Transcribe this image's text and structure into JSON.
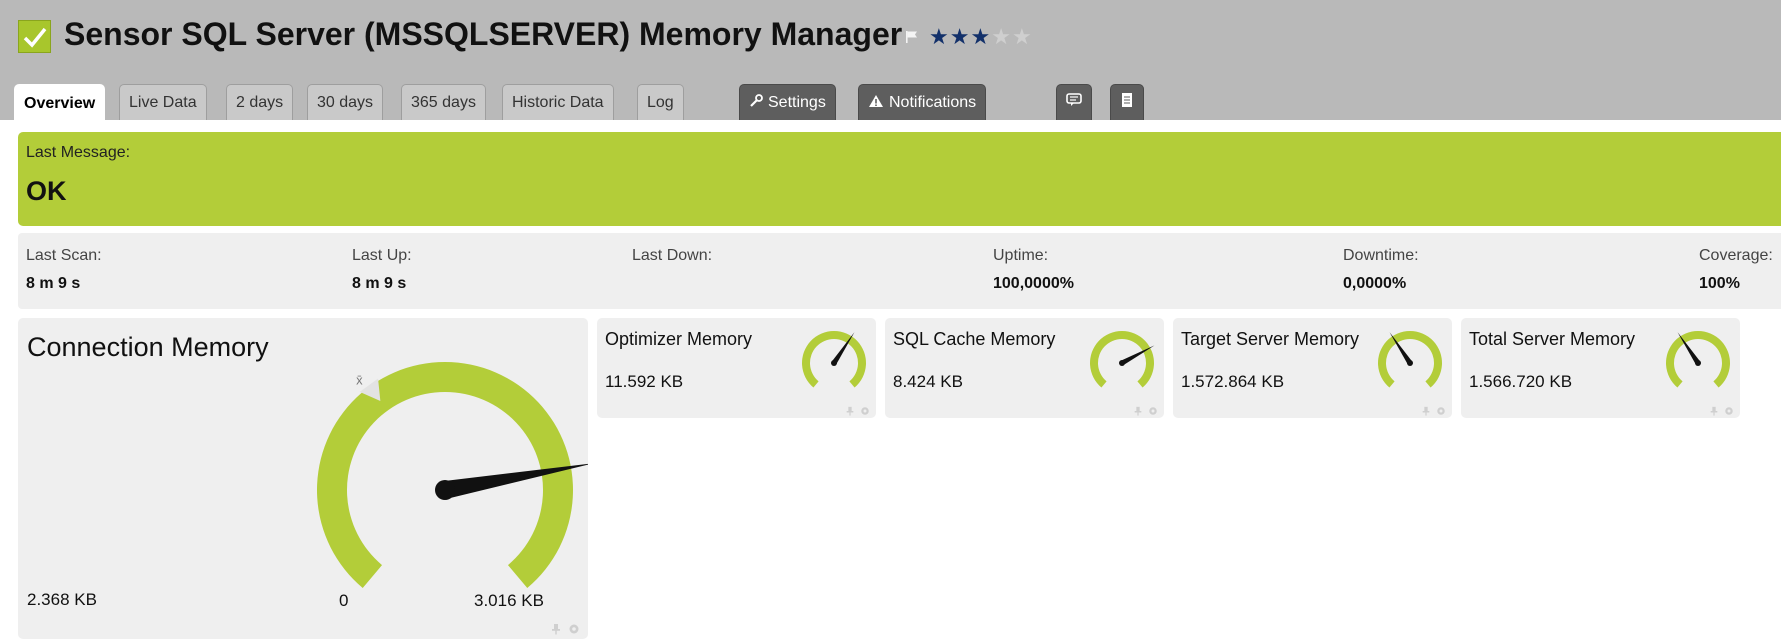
{
  "header": {
    "title": "Sensor SQL Server (MSSQLSERVER) Memory Manager",
    "status_icon": "check-icon",
    "flag_icon": "flag-icon",
    "priority_stars": 3,
    "priority_max": 5,
    "star_color": "#12306a",
    "bg_color": "#b9b9b9"
  },
  "tabs": [
    {
      "label": "Overview",
      "active": true
    },
    {
      "label": "Live Data"
    },
    {
      "label": "2 days"
    },
    {
      "label": "30 days"
    },
    {
      "label": "365 days"
    },
    {
      "label": "Historic Data"
    },
    {
      "label": "Log"
    },
    {
      "label": "Settings",
      "icon": "wrench-icon"
    },
    {
      "label": "Notifications",
      "icon": "warning-icon"
    },
    {
      "label": "",
      "icon": "comment-icon"
    },
    {
      "label": "",
      "icon": "document-icon"
    }
  ],
  "message": {
    "label": "Last Message:",
    "value": "OK",
    "color": "#b3cd39"
  },
  "stats": [
    {
      "label": "Last Scan:",
      "value": "8 m 9 s"
    },
    {
      "label": "Last Up:",
      "value": "8 m 9 s"
    },
    {
      "label": "Last Down:",
      "value": ""
    },
    {
      "label": "Uptime:",
      "value": "100,0000%"
    },
    {
      "label": "Downtime:",
      "value": "0,0000%"
    },
    {
      "label": "Coverage:",
      "value": "100%"
    }
  ],
  "primary_gauge": {
    "title": "Connection Memory",
    "value_text": "2.368 KB",
    "min_text": "0",
    "max_text": "3.016 KB",
    "level": 0.785,
    "gauge_color": "#b3cd39",
    "tools": [
      "pin-icon",
      "gear-icon"
    ]
  },
  "channel_gauges": [
    {
      "title": "Optimizer Memory",
      "value_text": "11.592 KB",
      "level": 0.62
    },
    {
      "title": "SQL Cache Memory",
      "value_text": "8.424 KB",
      "level": 0.72
    },
    {
      "title": "Target Server Memory",
      "value_text": "1.572.864 KB",
      "level": 0.38
    },
    {
      "title": "Total Server Memory",
      "value_text": "1.566.720 KB",
      "level": 0.38
    }
  ]
}
